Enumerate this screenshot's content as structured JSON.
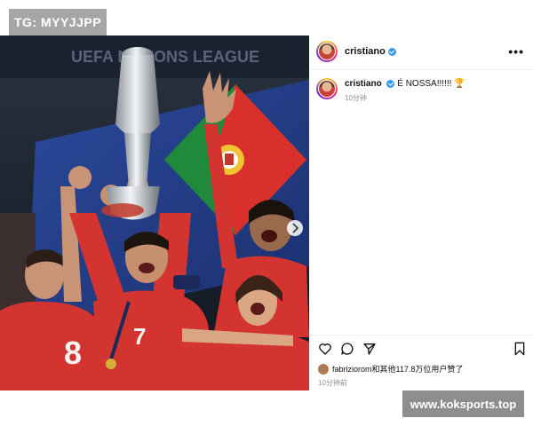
{
  "watermark_top": "TG: MYYJJPP",
  "watermark_bottom": "www.koksports.top",
  "post": {
    "author": "cristiano",
    "more_label": "•••",
    "caption_author": "cristiano",
    "caption_text": "É NOSSA!!!!!!",
    "caption_emoji": "🏆",
    "caption_time": "10分钟",
    "liked_by_text": "fabriziorom和其他117.8万位用户赞了",
    "post_time": "10分钟前"
  },
  "image": {
    "flag_colors": {
      "green": "#1f8a3c",
      "red": "#d9302b"
    },
    "jersey_number_center": "7",
    "jersey_number_left": "8",
    "jersey_color": "#d4342f"
  },
  "icons": [
    "heart-icon",
    "comment-icon",
    "share-icon",
    "bookmark-icon",
    "more-icon",
    "verified-icon",
    "trophy-icon",
    "chevron-right-icon"
  ]
}
